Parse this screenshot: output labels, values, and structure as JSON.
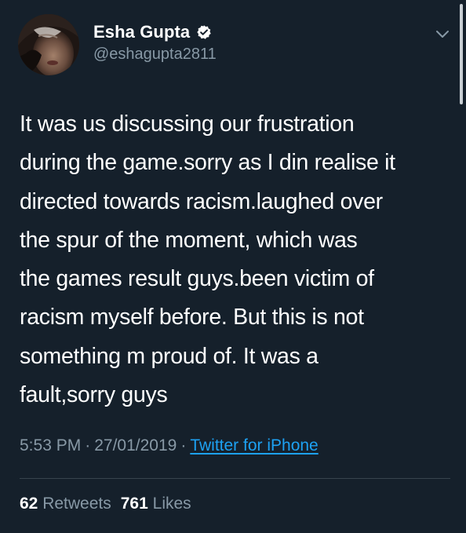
{
  "tweet": {
    "author": {
      "display_name": "Esha Gupta",
      "handle": "@eshagupta2811",
      "avatar_icon": "profile-photo",
      "verified_icon": "verified-badge-icon"
    },
    "body_lines": [
      "It was us discussing our frustration",
      "during the game.sorry as I din realise it",
      "directed towards racism.laughed over",
      "the spur of the moment, which was",
      "the games result guys.been victim of",
      "racism myself before. But this is not",
      "something m proud of. It was a",
      "fault,sorry guys"
    ],
    "meta": {
      "time": "5:53 PM",
      "separator": "·",
      "date": "27/01/2019",
      "source": "Twitter for iPhone"
    },
    "stats": {
      "retweets_count": "62",
      "retweets_label": "Retweets",
      "likes_count": "761",
      "likes_label": "Likes"
    }
  },
  "colors": {
    "background": "#15202b",
    "text_primary": "#ffffff",
    "text_secondary": "#8899a6",
    "link": "#1da1f2",
    "divider": "#38444d"
  }
}
